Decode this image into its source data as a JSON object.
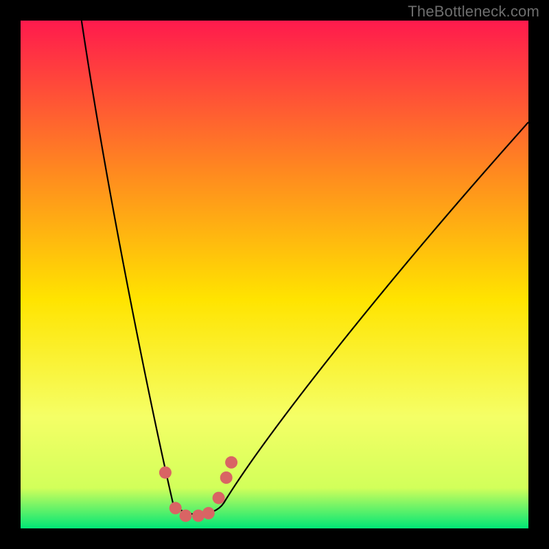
{
  "watermark": "TheBottleneck.com",
  "chart_data": {
    "type": "line",
    "title": "",
    "xlabel": "",
    "ylabel": "",
    "xlim": [
      0,
      100
    ],
    "ylim": [
      0,
      100
    ],
    "background_gradient": {
      "top": "#ff1a4d",
      "mid_upper": "#ff8a1f",
      "mid": "#ffe400",
      "lower": "#f5ff66",
      "bottom": "#00e676"
    },
    "curve": {
      "left_x_top": 12,
      "min_x_start": 30,
      "min_x_end": 40,
      "min_y": 2,
      "right_x_top": 100,
      "right_y_top": 80
    },
    "markers": [
      {
        "x": 28.5,
        "y": 11
      },
      {
        "x": 30.5,
        "y": 4
      },
      {
        "x": 32.5,
        "y": 2.5
      },
      {
        "x": 35.0,
        "y": 2.5
      },
      {
        "x": 37.0,
        "y": 3
      },
      {
        "x": 39.0,
        "y": 6
      },
      {
        "x": 40.5,
        "y": 10
      },
      {
        "x": 41.5,
        "y": 13
      }
    ],
    "marker_color": "#d96464",
    "curve_color": "#000000"
  }
}
